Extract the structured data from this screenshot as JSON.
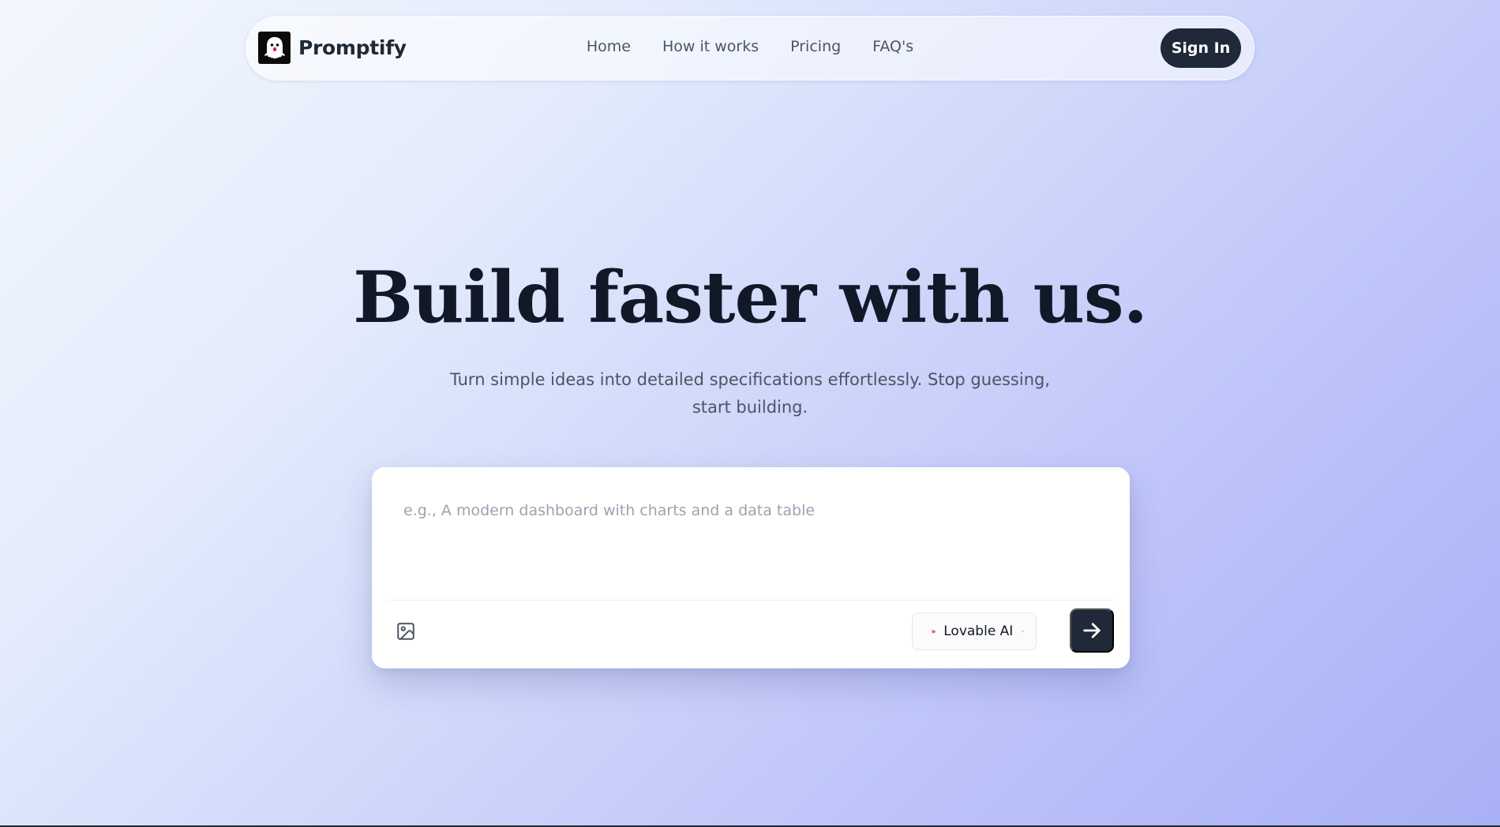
{
  "nav": {
    "brand": "Promptify",
    "logo_icon": "ghost-icon",
    "links": [
      "Home",
      "How it works",
      "Pricing",
      "FAQ's"
    ],
    "sign_in": "Sign In"
  },
  "hero": {
    "title": "Build faster with us.",
    "subtitle": "Turn simple ideas into detailed specifications effortlessly. Stop guessing, start building."
  },
  "prompt": {
    "placeholder": "e.g., A modern dashboard with charts and a data table",
    "value": "",
    "image_icon": "image-icon",
    "model": "Lovable AI",
    "model_icon": "lovable-heart-icon",
    "dropdown_icon": "chevron-down-icon",
    "send_icon": "arrow-right-icon"
  },
  "colors": {
    "dark": "#1f2937",
    "title": "#111827",
    "muted": "#4b5563",
    "placeholder": "#9ca3af",
    "gradient_start": "#f3f7fd",
    "gradient_end": "#a9b0f6"
  }
}
